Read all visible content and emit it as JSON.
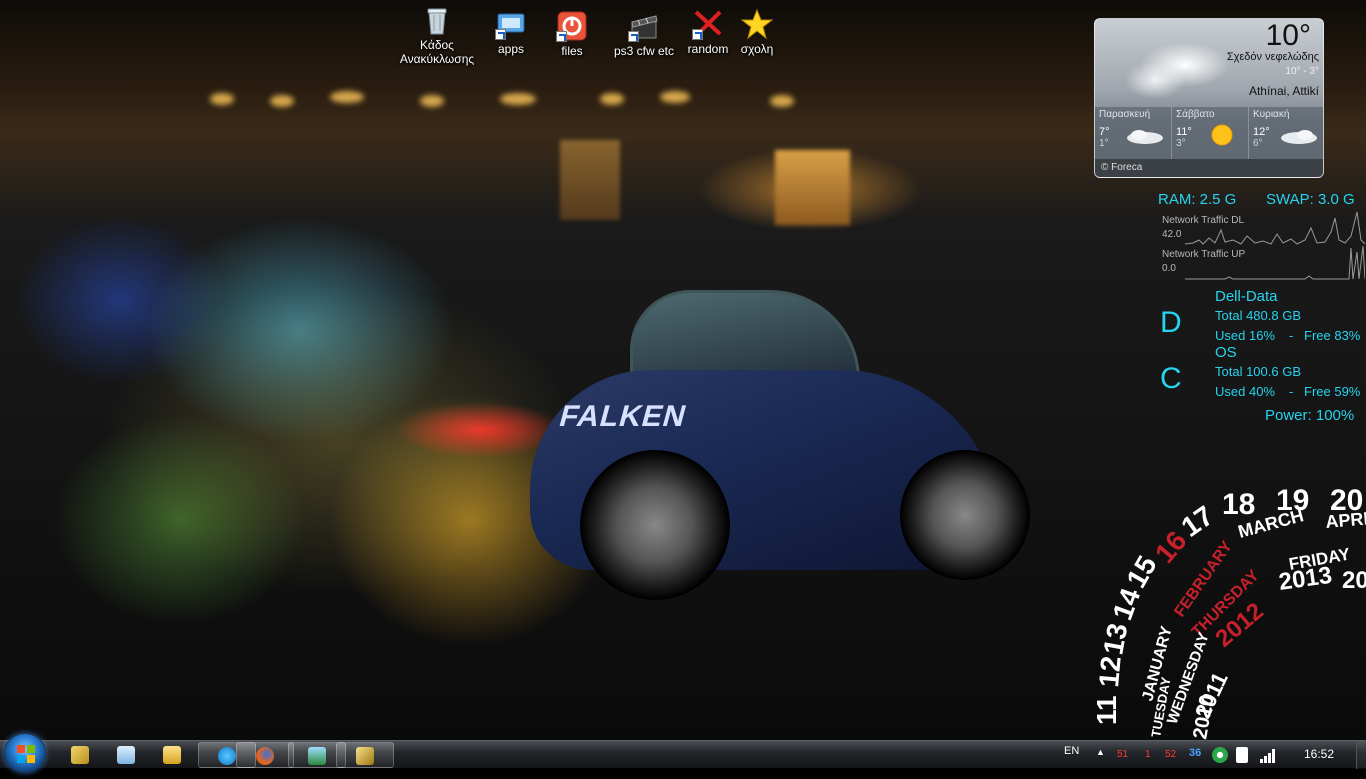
{
  "desktop_icons": [
    {
      "label": "Κάδος Ανακύκλωσης",
      "icon": "recycle-bin-icon"
    },
    {
      "label": "apps",
      "icon": "folder-shortcut-icon"
    },
    {
      "label": "files",
      "icon": "files-shortcut-icon"
    },
    {
      "label": "ps3 cfw etc",
      "icon": "clapper-shortcut-icon"
    },
    {
      "label": "random",
      "icon": "random-shortcut-icon"
    },
    {
      "label": "σχολη",
      "icon": "star-folder-icon"
    }
  ],
  "weather": {
    "temp": "10°",
    "desc": "Σχεδόν νεφελώδης",
    "range": "10° - 3°",
    "location": "Athínai, Attikí",
    "days": [
      {
        "name": "Παρασκευή",
        "hi": "7°",
        "lo": "1°",
        "icon": "cloud-icon"
      },
      {
        "name": "Σάββατο",
        "hi": "11°",
        "lo": "3°",
        "icon": "sun-icon"
      },
      {
        "name": "Κυριακή",
        "hi": "12°",
        "lo": "6°",
        "icon": "cloud-icon"
      }
    ],
    "footer": "© Foreca"
  },
  "sysmon": {
    "ram": "RAM: 2.5 G",
    "swap": "SWAP: 3.0 G",
    "net_dl_label": "Network Traffic DL",
    "net_dl_value": "42.0",
    "net_up_label": "Network Traffic UP",
    "net_up_value": "0.0"
  },
  "drives": [
    {
      "letter": "D",
      "name": "Dell-Data",
      "total": "Total 480.8 GB",
      "used": "Used 16%",
      "sep": "-",
      "free": "Free 83%"
    },
    {
      "letter": "C",
      "name": "OS",
      "total": "Total 100.6 GB",
      "used": "Used 40%",
      "sep": "-",
      "free": "Free 59%"
    }
  ],
  "power": "Power: 100%",
  "calendar": {
    "numbers": [
      "11",
      "12",
      "13",
      "14",
      "15",
      "16",
      "17",
      "18",
      "19",
      "20"
    ],
    "months": [
      "JANUARY",
      "FEBRUARY",
      "MARCH",
      "APRIL"
    ],
    "weekdays": [
      "TUESDAY",
      "WEDNESDAY",
      "THURSDAY",
      "FRIDAY"
    ],
    "years": [
      "2010",
      "2011",
      "2012",
      "2013",
      "20"
    ],
    "accent_color": "#c8202a"
  },
  "taskbar": {
    "language": "EN",
    "clock": "16:52",
    "tray_counters": [
      {
        "value": "51",
        "color": "#ff3a3a"
      },
      {
        "value": "1",
        "color": "#ff3a3a"
      },
      {
        "value": "52",
        "color": "#ff3a3a"
      },
      {
        "value": "36",
        "color": "#4aa0ff"
      }
    ],
    "apps": [
      {
        "name": "windows-explorer-icon",
        "active": false
      },
      {
        "name": "notepad-icon",
        "active": false
      },
      {
        "name": "folder-icon",
        "active": false
      },
      {
        "name": "skype-icon",
        "active": true
      },
      {
        "name": "firefox-icon",
        "active": true
      },
      {
        "name": "network-app-icon",
        "active": true
      },
      {
        "name": "tool-app-icon",
        "active": true
      }
    ]
  },
  "colors": {
    "accent": "#26d4f0",
    "taskbar": "#1c1f23"
  }
}
